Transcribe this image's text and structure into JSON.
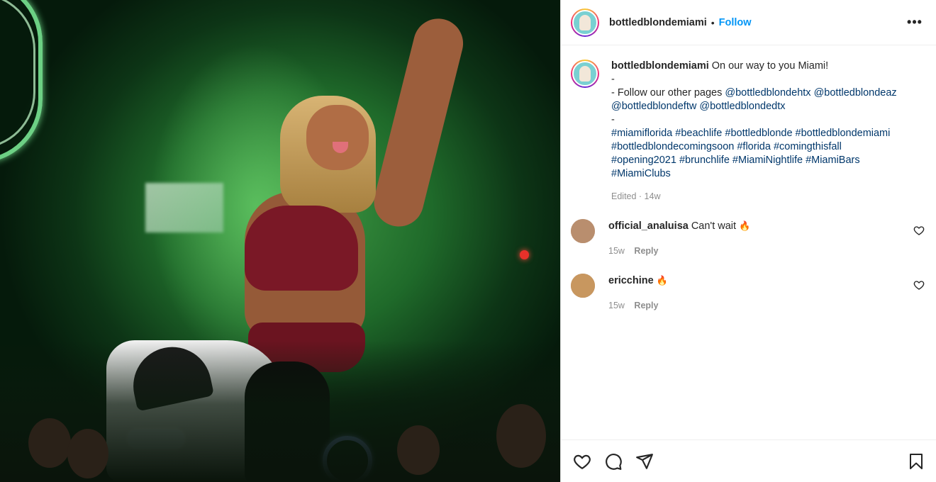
{
  "post": {
    "username": "bottledblondemiami",
    "separator": "•",
    "follow_label": "Follow",
    "more_label": "•••"
  },
  "caption": {
    "username": "bottledblondemiami",
    "first_line": "On our way to you Miami!",
    "lines": [
      "-",
      "- Follow our other pages @bottledblondehtx @bottledblondeaz",
      "@bottledblondeftw @bottledblondedtx",
      "-",
      "#miamiflorida #beachlife #bottledblonde #bottledblondemiami",
      "#bottledblondecomingsoon #florida #comingthisfall",
      "#opening2021 #brunchlife #MiamiNightlife #MiamiBars",
      "#MiamiClubs"
    ],
    "meta": "Edited · 14w"
  },
  "comments": [
    {
      "username": "official_analuisa",
      "text": "Can't wait",
      "emoji": "🔥",
      "time": "15w",
      "reply_label": "Reply"
    },
    {
      "username": "ericchine",
      "text": "",
      "emoji": "🔥",
      "time": "15w",
      "reply_label": "Reply"
    }
  ],
  "icons": {
    "like": "heart-icon",
    "comment": "comment-icon",
    "share": "paper-plane-icon",
    "save": "bookmark-icon",
    "comment_like": "heart-icon"
  },
  "colors": {
    "link": "#0095f6",
    "hashtag": "#00376b",
    "muted": "#8e8e8e",
    "text": "#262626"
  }
}
